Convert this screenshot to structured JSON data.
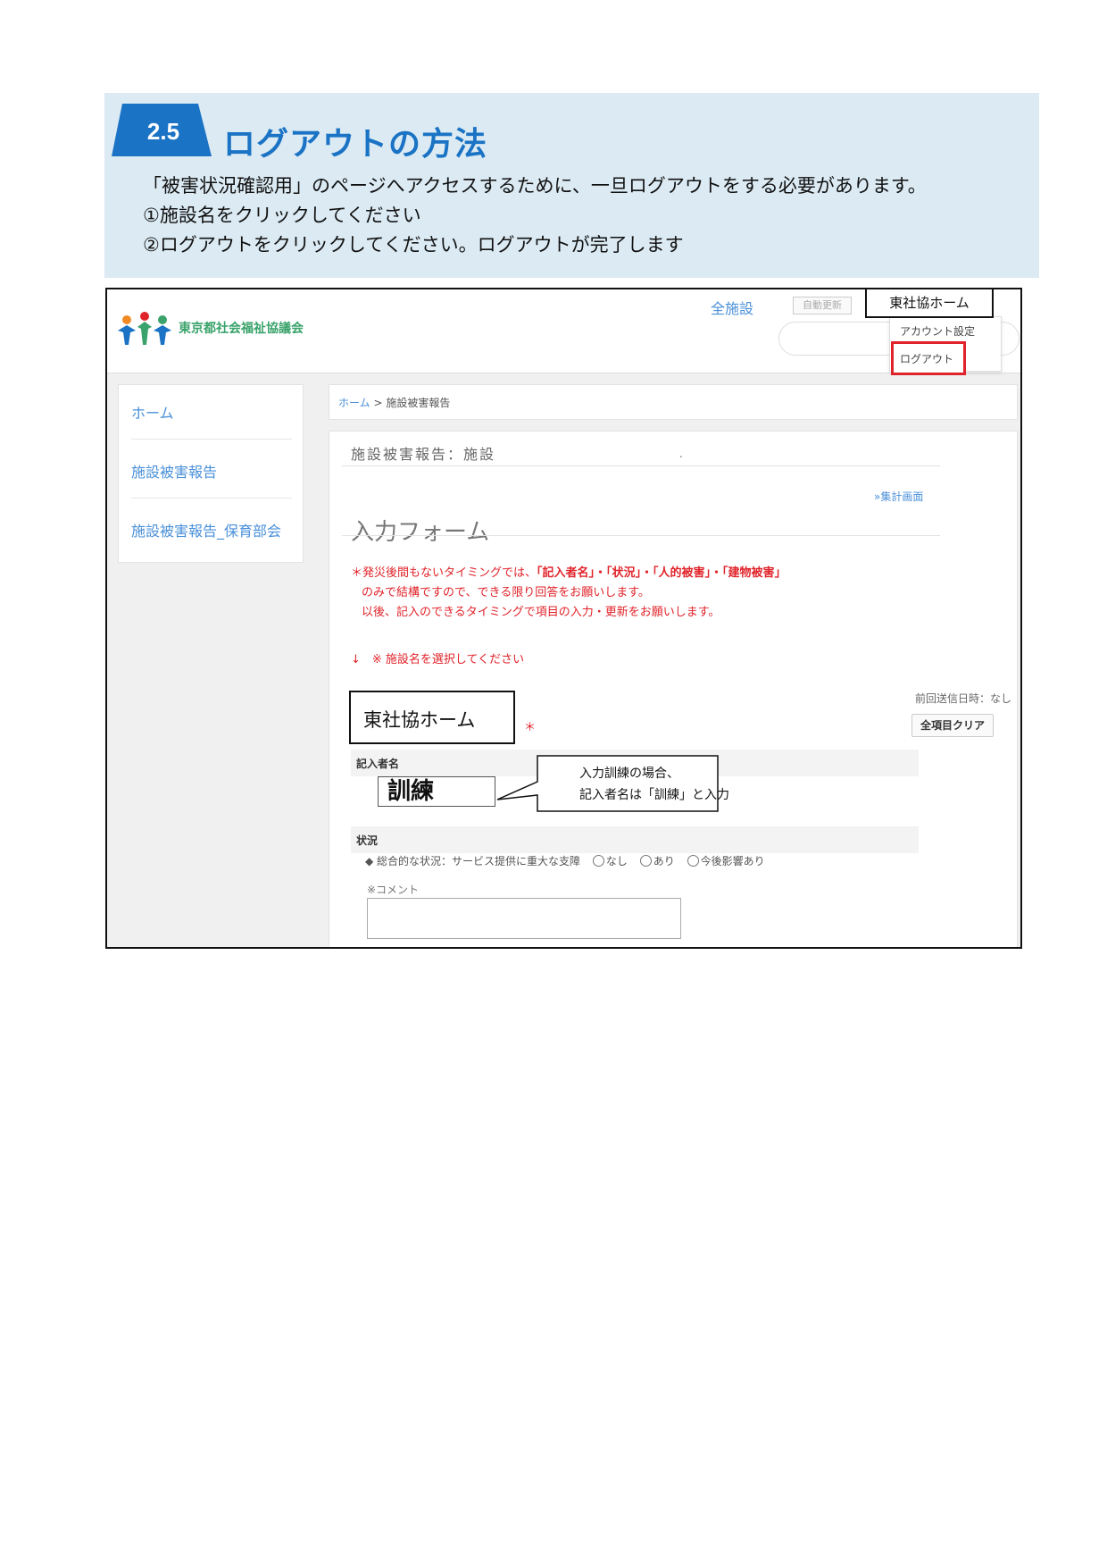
{
  "header": {
    "section_number": "2.5",
    "section_title": "ログアウトの方法",
    "lines": [
      "「被害状況確認用」のページへアクセスするために、一旦ログアウトをする必要があります。",
      "①施設名をクリックしてください",
      "②ログアウトをクリックしてください。ログアウトが完了します"
    ],
    "colors": {
      "panel": "#dbeaf3",
      "accent": "#1a73c4"
    }
  },
  "app": {
    "org_name": "東京都社会福祉協議会",
    "facility_link": "全施設",
    "auto_update": "自動更新",
    "user_menu": {
      "user": "東社協ホーム",
      "account": "アカウント設定",
      "logout": "ログアウト"
    },
    "sidebar": [
      "ホーム",
      "施設被害報告",
      "施設被害報告_保育部会"
    ],
    "breadcrumb": {
      "home": "ホーム",
      "sep": ">",
      "current": "施設被害報告"
    },
    "main": {
      "title": "施設被害報告：施設",
      "dot": ".",
      "summary_link": "»集計画面",
      "form_title": "入力フォーム",
      "notice": {
        "prefix": "＊発災後間もないタイミングでは、",
        "fields": "「記入者名」・「状況」・「人的被害」・「建物被害」",
        "line2": "のみで結構ですので、できる限り回答をお願いします。",
        "line3": "以後、記入のできるタイミングで項目の入力・更新をお願いします。"
      },
      "select_hint": "↓　※ 施設名を選択してください",
      "facility_value": "東社協ホーム",
      "required_mark": "＊",
      "last_sent": "前回送信日時：なし",
      "clear_button": "全項目クリア",
      "reporter_label": "記入者名",
      "reporter_value": "訓練",
      "callout": [
        "入力訓練の場合、",
        "記入者名は「訓練」と入力"
      ],
      "status_label": "状況",
      "status_question": "◆ 総合的な状況：サービス提供に重大な支障",
      "status_options": [
        "なし",
        "あり",
        "今後影響あり"
      ],
      "comment_label": "※コメント"
    }
  }
}
